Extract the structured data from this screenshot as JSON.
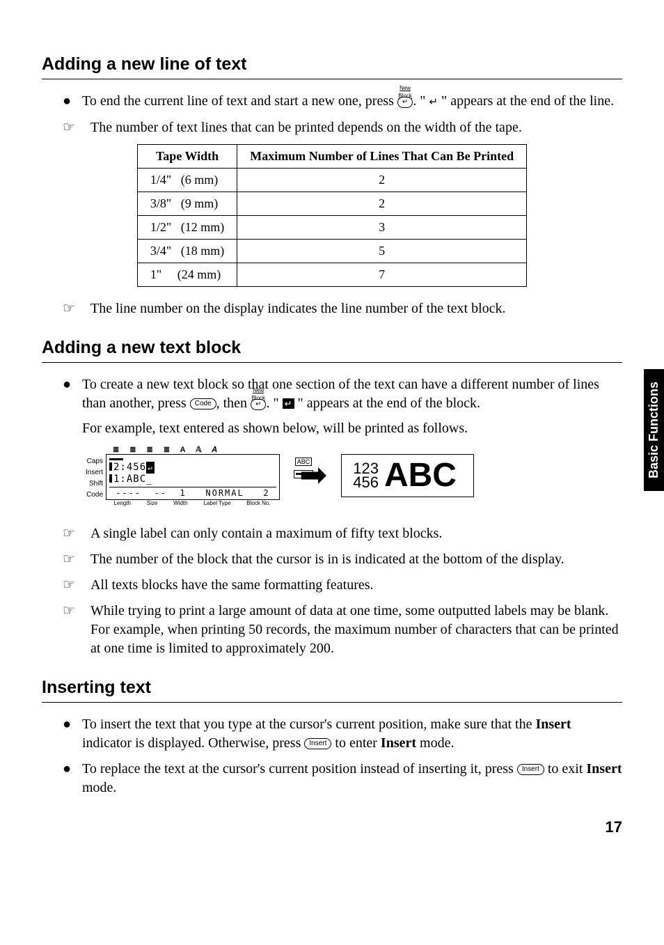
{
  "side_tab": "Basic Functions",
  "page_number": "17",
  "sec1": {
    "title": "Adding a new line of text",
    "bullet": {
      "pre": "To end the current line of text and start a new one, press ",
      "key_top": "New Block",
      "key_glyph": "↵",
      "post1": ". \" ",
      "ret": "↵",
      "post2": " \" appears at the end of the line."
    },
    "note1": "The number of text lines that can be printed depends on the width of the tape.",
    "table": {
      "h1": "Tape Width",
      "h2": "Maximum Number of Lines That Can Be Printed",
      "rows": [
        {
          "w": "1/4\"   (6 mm)",
          "n": "2"
        },
        {
          "w": "3/8\"   (9 mm)",
          "n": "2"
        },
        {
          "w": "1/2\"   (12 mm)",
          "n": "3"
        },
        {
          "w": "3/4\"   (18 mm)",
          "n": "5"
        },
        {
          "w": "1\"     (24 mm)",
          "n": "7"
        }
      ]
    },
    "note2": "The line number on the display indicates the line number of the text block."
  },
  "sec2": {
    "title": "Adding a new text block",
    "bullet": {
      "pre": "To create a new text block so that one section of the text can have a different number of lines than another, press ",
      "k_code": "Code",
      "mid": ", then ",
      "key_top": "New Block",
      "key_glyph": "↵",
      "post1": ". \" ",
      "post2": " \" appears at the end of the block."
    },
    "example_lead": "For example, text entered as shown below, will be printed as follows.",
    "lcd": {
      "top_icons": "≣ ≣ ≣ ≣   A 𝔸 𝘈",
      "side": [
        "Caps",
        "Insert",
        "Shift",
        "Code"
      ],
      "line1": "2:456",
      "line2": "1:ABC_",
      "status": " ----  --  1   NORMAL   2",
      "bottom": [
        "Length",
        "Size",
        "Width",
        "Label Type",
        "Block No."
      ],
      "abc": "ABC"
    },
    "printed": {
      "l1": "123",
      "l2": "456",
      "abc": "ABC"
    },
    "notes": [
      "A single label can only contain a maximum of fifty text blocks.",
      "The number of the block that the cursor is in is indicated at the bottom of the display.",
      "All texts blocks have the same formatting features.",
      "While trying to print a large amount of data at one time, some outputted labels may be blank. For example, when printing 50 records, the maximum number of characters that can be printed at one time is limited to approximately 200."
    ]
  },
  "sec3": {
    "title": "Inserting text",
    "b1": {
      "pre": "To insert the text that you type at the cursor's current position, make sure that the ",
      "bold1": "Insert",
      "mid": " indicator is displayed. Otherwise, press ",
      "key": "Insert",
      "post1": " to enter ",
      "bold2": "Insert",
      "post2": " mode."
    },
    "b2": {
      "pre": "To replace the text at the cursor's current position instead of inserting it, press ",
      "key": "Insert",
      "post1": " to exit ",
      "bold1": "Insert",
      "post2": " mode."
    }
  }
}
